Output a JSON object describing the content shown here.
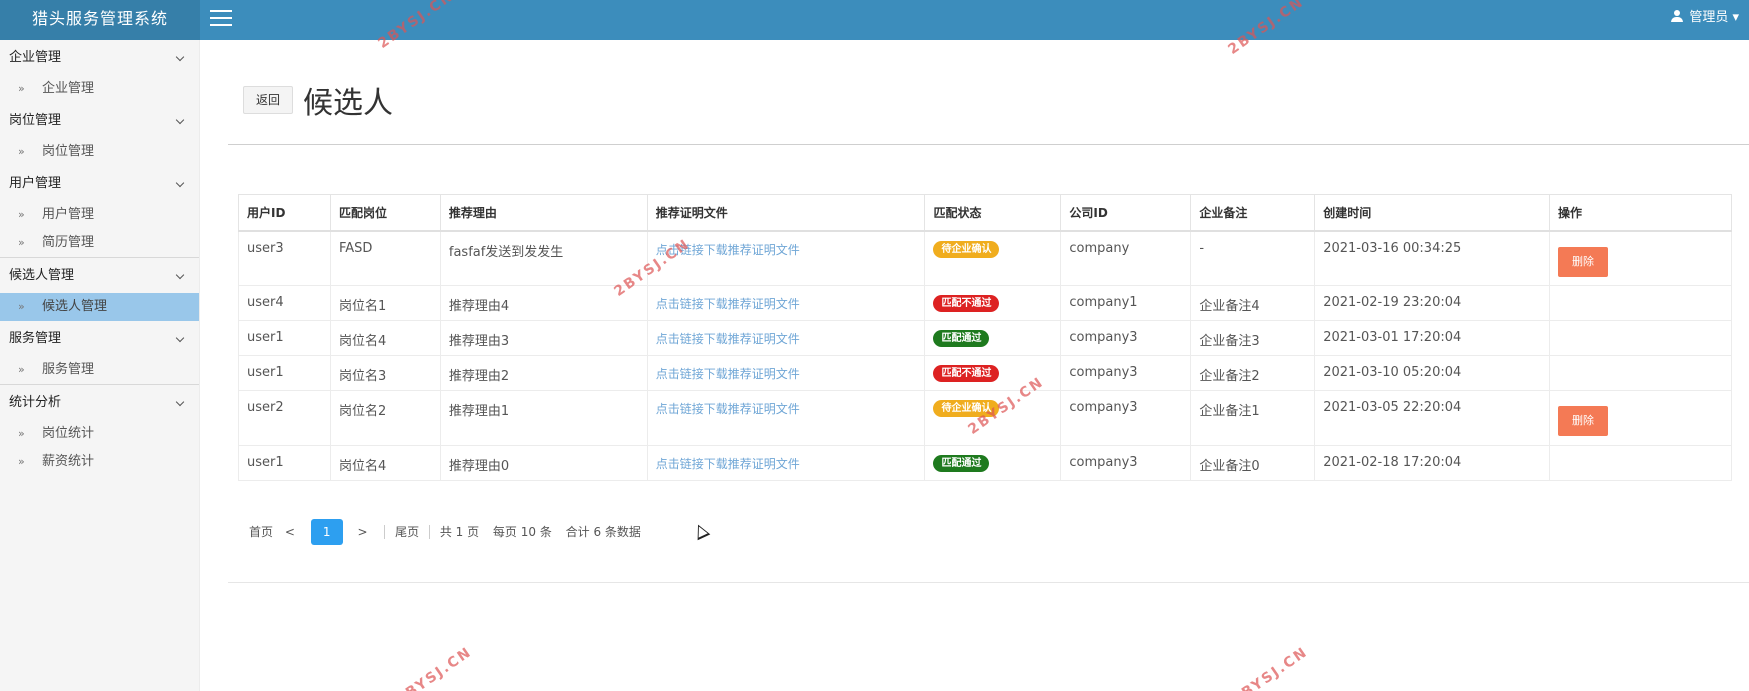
{
  "header": {
    "app_title": "猎头服务管理系统",
    "user_label": "管理员"
  },
  "sidebar": {
    "groups": [
      {
        "label": "企业管理",
        "items": [
          "企业管理"
        ]
      },
      {
        "label": "岗位管理",
        "items": [
          "岗位管理"
        ]
      },
      {
        "label": "用户管理",
        "items": [
          "用户管理",
          "简历管理"
        ]
      },
      {
        "label": "候选人管理",
        "items": [
          "候选人管理"
        ]
      },
      {
        "label": "服务管理",
        "items": [
          "服务管理"
        ]
      },
      {
        "label": "统计分析",
        "items": [
          "岗位统计",
          "薪资统计"
        ]
      }
    ],
    "active_item": "候选人管理",
    "item_prefix": "»"
  },
  "page": {
    "back_label": "返回",
    "title": "候选人"
  },
  "table": {
    "columns": [
      "用户ID",
      "匹配岗位",
      "推荐理由",
      "推荐证明文件",
      "匹配状态",
      "公司ID",
      "企业备注",
      "创建时间",
      "操作"
    ],
    "rows": [
      {
        "user_id": "user3",
        "job": "FASD",
        "reason": "fasfaf发送到发发生",
        "file": "点击链接下载推荐证明文件",
        "status": "待企业确认",
        "status_type": "pending",
        "company": "company",
        "remark": "-",
        "created": "2021-03-16 00:34:25",
        "action": "删除"
      },
      {
        "user_id": "user4",
        "job": "岗位名1",
        "reason": "推荐理由4",
        "file": "点击链接下载推荐证明文件",
        "status": "匹配不通过",
        "status_type": "fail",
        "company": "company1",
        "remark": "企业备注4",
        "created": "2021-02-19 23:20:04",
        "action": ""
      },
      {
        "user_id": "user1",
        "job": "岗位名4",
        "reason": "推荐理由3",
        "file": "点击链接下载推荐证明文件",
        "status": "匹配通过",
        "status_type": "pass",
        "company": "company3",
        "remark": "企业备注3",
        "created": "2021-03-01 17:20:04",
        "action": ""
      },
      {
        "user_id": "user1",
        "job": "岗位名3",
        "reason": "推荐理由2",
        "file": "点击链接下载推荐证明文件",
        "status": "匹配不通过",
        "status_type": "fail",
        "company": "company3",
        "remark": "企业备注2",
        "created": "2021-03-10 05:20:04",
        "action": ""
      },
      {
        "user_id": "user2",
        "job": "岗位名2",
        "reason": "推荐理由1",
        "file": "点击链接下载推荐证明文件",
        "status": "待企业确认",
        "status_type": "pending",
        "company": "company3",
        "remark": "企业备注1",
        "created": "2021-03-05 22:20:04",
        "action": "删除"
      },
      {
        "user_id": "user1",
        "job": "岗位名4",
        "reason": "推荐理由0",
        "file": "点击链接下载推荐证明文件",
        "status": "匹配通过",
        "status_type": "pass",
        "company": "company3",
        "remark": "企业备注0",
        "created": "2021-02-18 17:20:04",
        "action": ""
      }
    ]
  },
  "pager": {
    "first": "首页",
    "prev": "<",
    "current": "1",
    "next": ">",
    "last": "尾页",
    "total_pages": "共 1 页",
    "per_page": "每页 10 条",
    "total_records": "合计 6 条数据"
  },
  "watermark": "2BYSJ.CN",
  "colors": {
    "header": "#3c8dbc",
    "active_nav": "#99c7ea",
    "pending": "#f0ad1e",
    "fail": "#dd2222",
    "pass": "#1e7a1e",
    "delete": "#f47a55",
    "pager_active": "#2d9ff0"
  }
}
